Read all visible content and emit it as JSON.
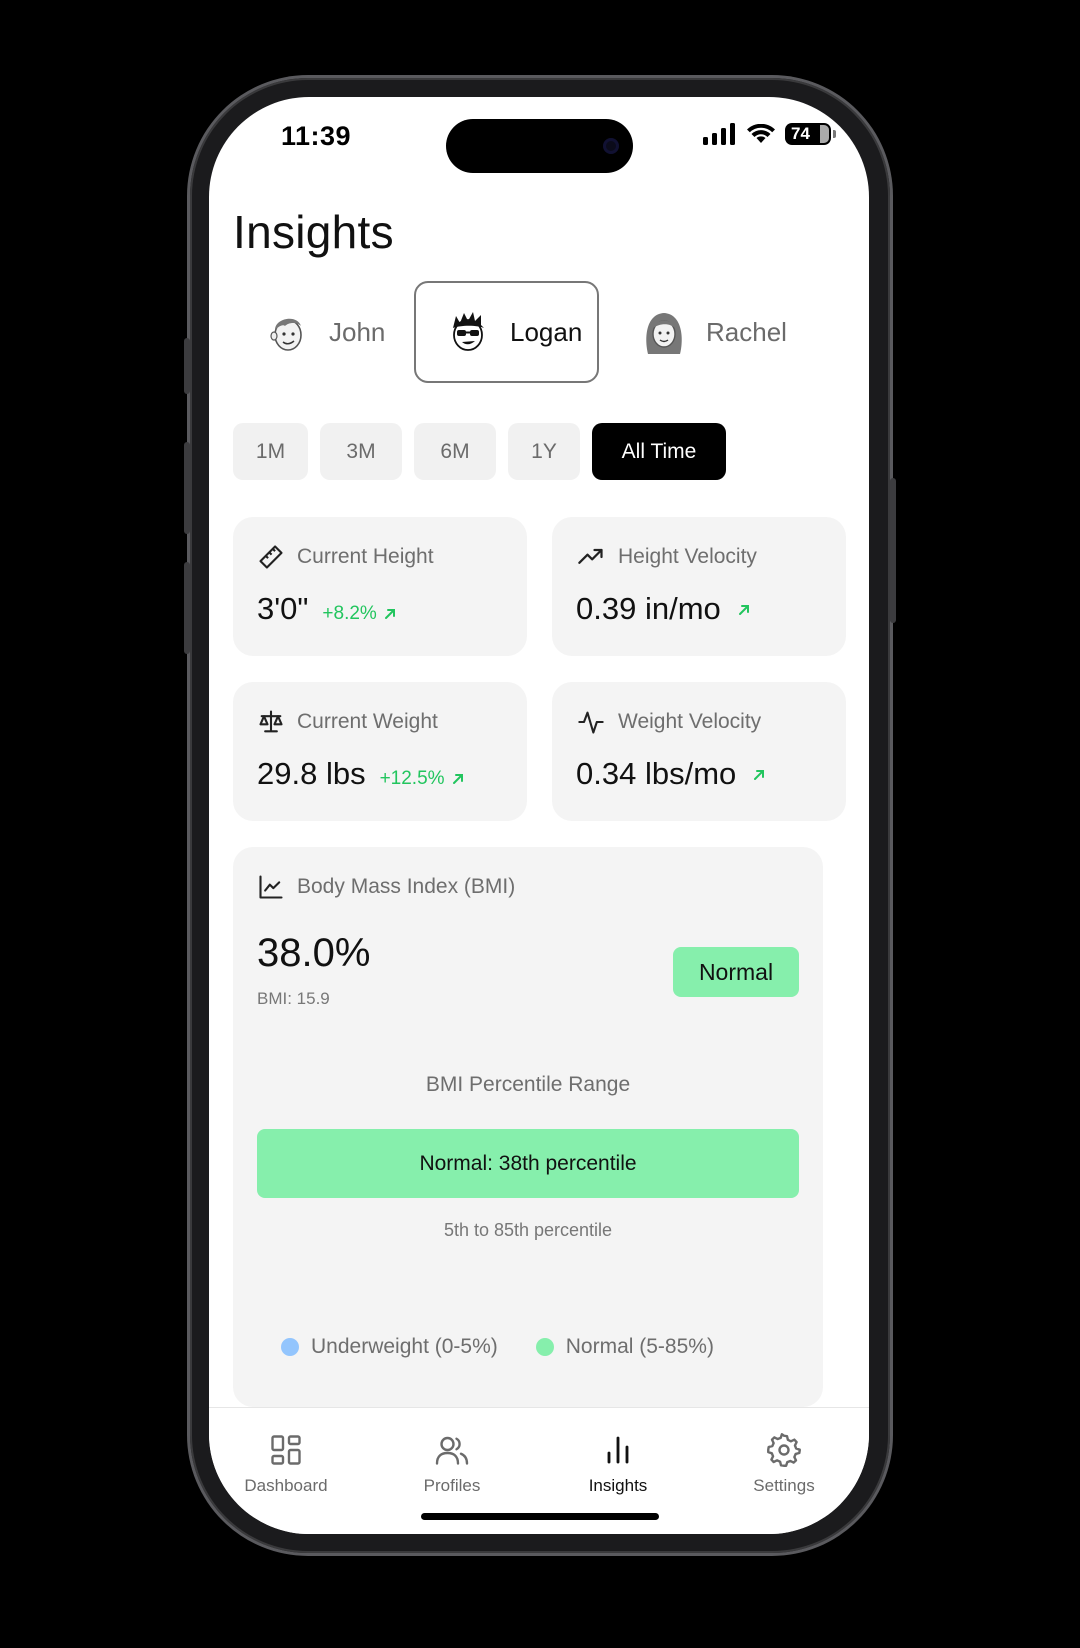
{
  "status": {
    "time": "11:39",
    "battery": "74"
  },
  "page_title": "Insights",
  "profiles": [
    {
      "name": "John",
      "avatar_icon": "boy-face-icon",
      "active": false
    },
    {
      "name": "Logan",
      "avatar_icon": "sunglasses-face-icon",
      "active": true
    },
    {
      "name": "Rachel",
      "avatar_icon": "girl-face-icon",
      "active": false
    }
  ],
  "ranges": [
    {
      "label": "1M",
      "active": false
    },
    {
      "label": "3M",
      "active": false
    },
    {
      "label": "6M",
      "active": false
    },
    {
      "label": "1Y",
      "active": false
    },
    {
      "label": "All Time",
      "active": true
    }
  ],
  "metrics": {
    "current_height": {
      "label": "Current Height",
      "value": "3'0\"",
      "delta": "+8.2%",
      "icon": "ruler-icon"
    },
    "height_velocity": {
      "label": "Height Velocity",
      "value": "0.39 in/mo",
      "icon": "trending-up-icon"
    },
    "current_weight": {
      "label": "Current Weight",
      "value": "29.8 lbs",
      "delta": "+12.5%",
      "icon": "scale-icon"
    },
    "weight_velocity": {
      "label": "Weight Velocity",
      "value": "0.34 lbs/mo",
      "icon": "activity-icon"
    }
  },
  "bmi": {
    "label": "Body Mass Index (BMI)",
    "percentile": "38.0%",
    "bmi_value": "BMI: 15.9",
    "status": "Normal",
    "range_title": "BMI Percentile Range",
    "range_bar_text": "Normal: 38th percentile",
    "range_note": "5th to 85th percentile",
    "legend": [
      {
        "label": "Underweight (0-5%)",
        "color": "#93c5fd"
      },
      {
        "label": "Normal (5-85%)",
        "color": "#86efac"
      }
    ]
  },
  "tabs": [
    {
      "label": "Dashboard",
      "icon": "grid-icon",
      "active": false
    },
    {
      "label": "Profiles",
      "icon": "users-icon",
      "active": false
    },
    {
      "label": "Insights",
      "icon": "bar-chart-icon",
      "active": true
    },
    {
      "label": "Settings",
      "icon": "gear-icon",
      "active": false
    }
  ],
  "colors": {
    "accent_green": "#22c55e",
    "badge_green": "#86efac",
    "active_black": "#000000"
  }
}
